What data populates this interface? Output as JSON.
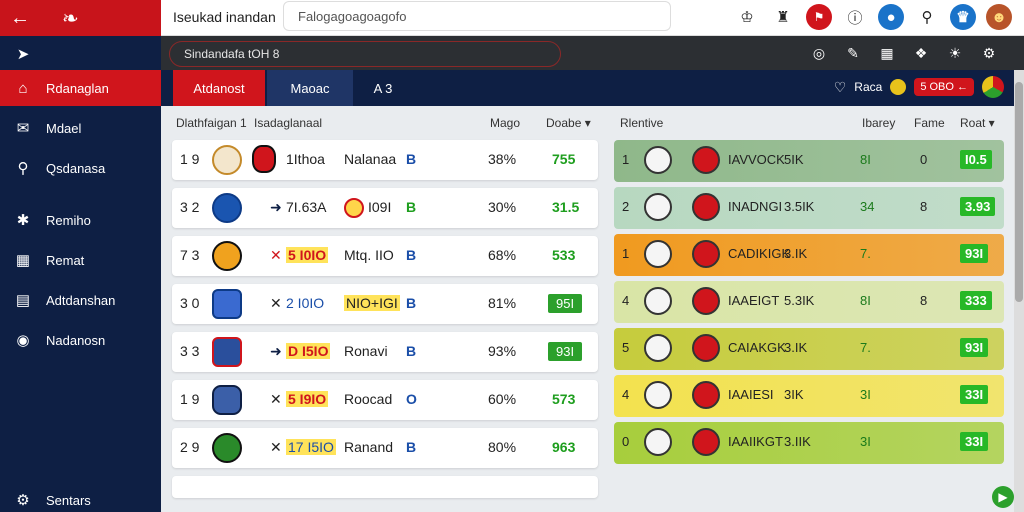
{
  "brand": {
    "back_icon": "back-arrow-icon",
    "logo_icon": "crest-logo-icon"
  },
  "topbar": {
    "title": "Iseukad inandan",
    "search_placeholder": "Falogagoagoagofo",
    "icons": [
      "trophy-icon",
      "shirt-icon",
      "flag-icon",
      "info-icon",
      "bell-icon",
      "search-icon",
      "user-icon",
      "avatar"
    ]
  },
  "sidebar": {
    "items": [
      {
        "label": "",
        "icon": "share-icon"
      },
      {
        "label": "Rdanaglan",
        "icon": "home-icon"
      },
      {
        "label": "Mdael",
        "icon": "chat-icon"
      },
      {
        "label": "Qsdanasa",
        "icon": "search-icon"
      },
      {
        "label": "Remiho",
        "icon": "tools-icon"
      },
      {
        "label": "Remat",
        "icon": "calendar-icon"
      },
      {
        "label": "Adtdanshan",
        "icon": "list-icon"
      },
      {
        "label": "Nadanosn",
        "icon": "globe-icon"
      },
      {
        "label": "Sentars",
        "icon": "settings-icon"
      }
    ]
  },
  "subbar": {
    "filter_text": "Sindandafa tOH 8"
  },
  "tabs": {
    "tab1": "Atdanost",
    "tab2": "Maoac",
    "tab3": "A 3",
    "right_label": "Raca",
    "right_pill": "5 OBO  ←"
  },
  "left_table": {
    "headers": [
      "Dlathfaigan 1",
      "Isadaglanaal",
      "Mago",
      "Doabe ▾"
    ],
    "rows": [
      {
        "rank": "1 9",
        "num": "1Ithoa",
        "name": "Nalanaa",
        "pos": "B",
        "pct": "38%",
        "val": "755",
        "boxed": false
      },
      {
        "rank": "3 2",
        "num": "7I.63A",
        "name": "I09I",
        "pos": "B",
        "pct": "30%",
        "val": "31.5",
        "boxed": false
      },
      {
        "rank": "7 3",
        "num": "5 I0IO",
        "name": "Mtq. IIO",
        "pos": "B",
        "pct": "68%",
        "val": "533",
        "boxed": false
      },
      {
        "rank": "3 0",
        "num": "2 I0IO",
        "name": "NIO+IGI",
        "pos": "B",
        "pct": "81%",
        "val": "95I",
        "boxed": true
      },
      {
        "rank": "3 3",
        "num": "D I5IO",
        "name": "Ronavi",
        "pos": "B",
        "pct": "93%",
        "val": "93I",
        "boxed": true
      },
      {
        "rank": "1 9",
        "num": "5 I9IO",
        "name": "Roocad",
        "pos": "O",
        "pct": "60%",
        "val": "573",
        "boxed": false
      },
      {
        "rank": "2 9",
        "num": "17 I5IO",
        "name": "Ranand",
        "pos": "B",
        "pct": "80%",
        "val": "963",
        "boxed": false
      }
    ]
  },
  "right_table": {
    "headers": [
      "Rlentive",
      "Ibarey",
      "Fame",
      "Roat ▾"
    ],
    "rows": [
      {
        "rank": "1",
        "name": "IAVVOCK",
        "val": "5IK",
        "pts": "8I",
        "g": "0",
        "score": "I0.5",
        "color": "#8fb88a"
      },
      {
        "rank": "2",
        "name": "INADNGI",
        "val": "3.5IK",
        "pts": "34",
        "g": "8",
        "score": "3.93",
        "color": "#b7d8c0"
      },
      {
        "rank": "1",
        "name": "CADIKIGK",
        "val": "3.IK",
        "pts": "7.",
        "g": "",
        "score": "93I",
        "color": "#f09a1f"
      },
      {
        "rank": "4",
        "name": "IAAEIGT",
        "val": "5.3IK",
        "pts": "8I",
        "g": "8",
        "score": "333",
        "color": "#d9e5a6"
      },
      {
        "rank": "5",
        "name": "CAIAKGK",
        "val": "3.IK",
        "pts": "7.",
        "g": "",
        "score": "93I",
        "color": "#c6cc3c"
      },
      {
        "rank": "4",
        "name": "IAAIESI",
        "val": "3IK",
        "pts": "3I",
        "g": "",
        "score": "33I",
        "color": "#f3e24e"
      },
      {
        "rank": "0",
        "name": "IAAIIKGT",
        "val": "3.IIK",
        "pts": "3I",
        "g": "",
        "score": "33I",
        "color": "#a7ce3c"
      }
    ]
  }
}
